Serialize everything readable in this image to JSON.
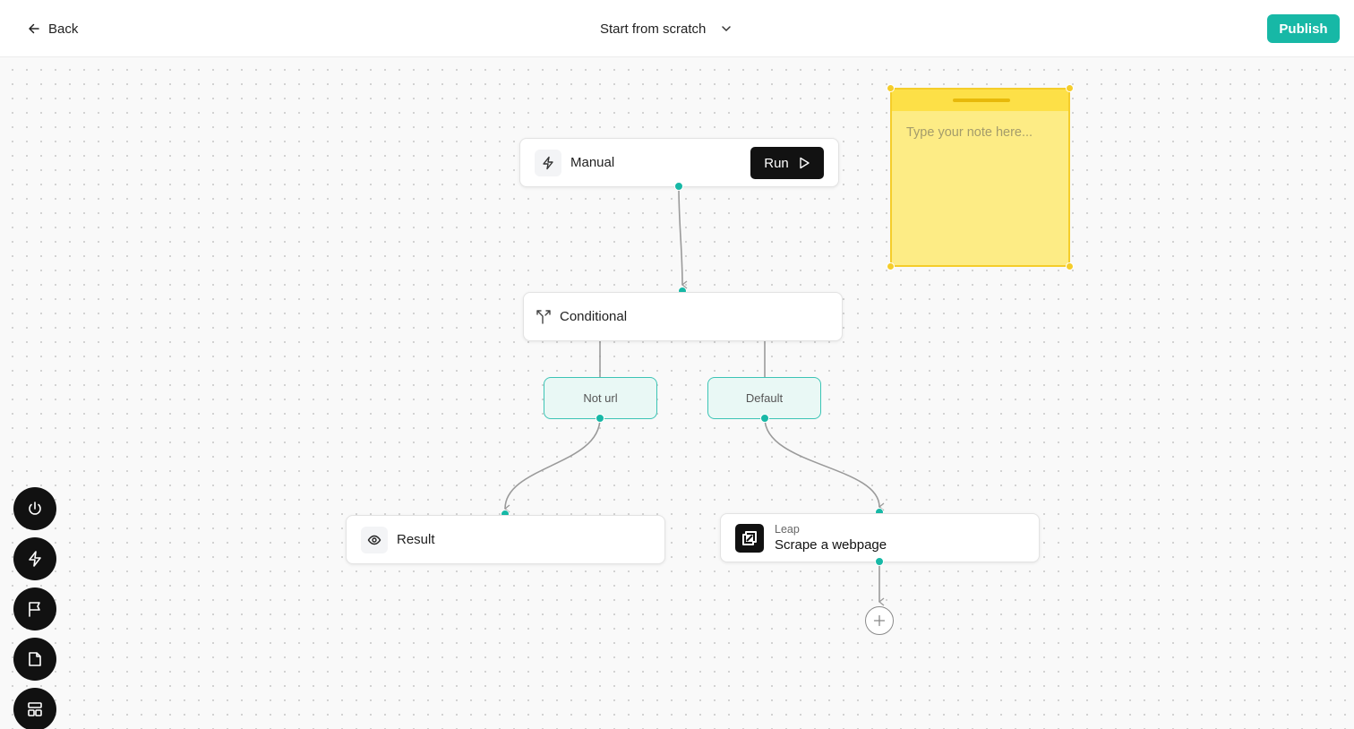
{
  "header": {
    "back_label": "Back",
    "template_label": "Start from scratch",
    "publish_label": "Publish"
  },
  "nodes": {
    "manual": {
      "label": "Manual",
      "run_label": "Run",
      "icon": "lightning-icon"
    },
    "conditional": {
      "label": "Conditional",
      "icon": "split-arrows-icon"
    },
    "branch_not_url": {
      "label": "Not url"
    },
    "branch_default": {
      "label": "Default"
    },
    "result": {
      "label": "Result",
      "icon": "eye-icon"
    },
    "leap": {
      "provider": "Leap",
      "label": "Scrape a webpage",
      "icon": "leap-logo"
    }
  },
  "sticky_note": {
    "placeholder": "Type your note here..."
  },
  "sidebar_tools": [
    "power-icon",
    "lightning-icon",
    "flag-icon",
    "file-icon",
    "layout-icon"
  ],
  "colors": {
    "accent": "#17b8a6",
    "sticky": "#fdec85",
    "branch_bg": "#e9f8f5",
    "dark": "#111111"
  }
}
